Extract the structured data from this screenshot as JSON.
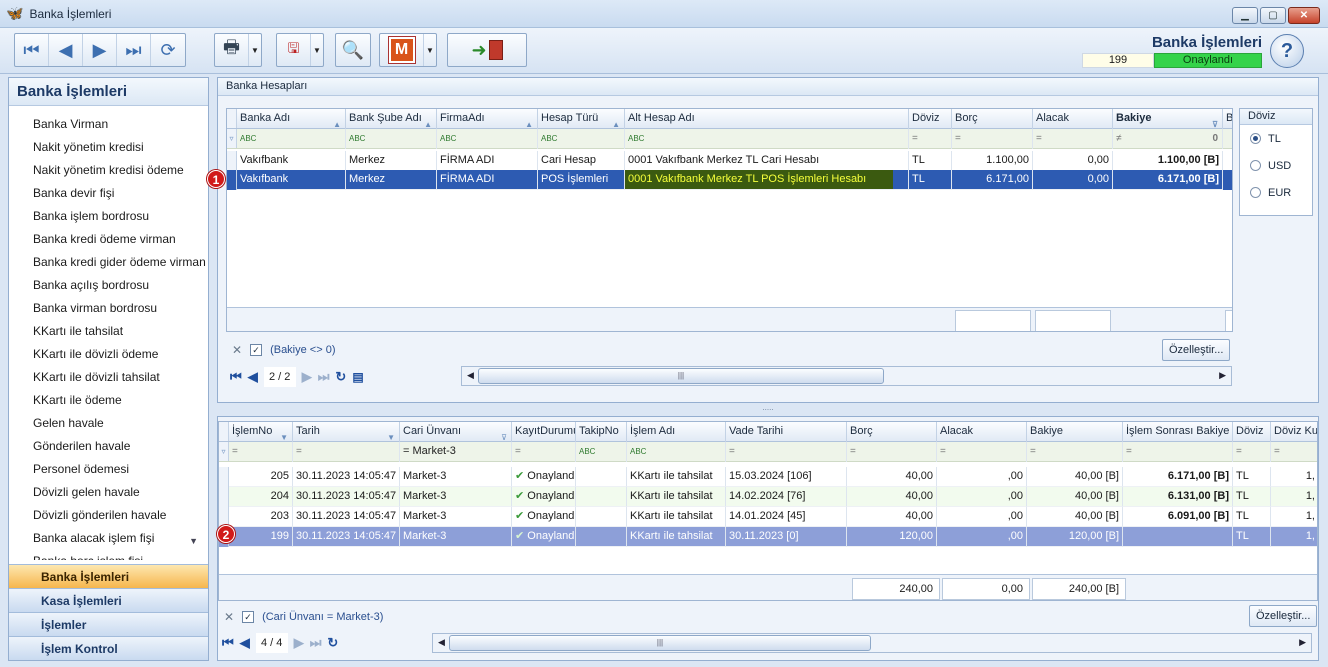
{
  "window": {
    "title": "Banka İşlemleri"
  },
  "header": {
    "title": "Banka İşlemleri",
    "doc_number": "199",
    "status": "Onaylandı"
  },
  "left_panel": {
    "title": "Banka İşlemleri",
    "items": [
      "Banka Virman",
      "Nakit yönetim kredisi",
      "Nakit yönetim kredisi ödeme",
      "Banka devir fişi",
      "Banka işlem bordrosu",
      "Banka kredi ödeme virman",
      "Banka kredi gider ödeme virman",
      "Banka açılış bordrosu",
      "Banka virman bordrosu",
      "KKartı ile tahsilat",
      "KKartı ile dövizli ödeme",
      "KKartı ile dövizli tahsilat",
      "KKartı ile ödeme",
      "Gelen havale",
      "Gönderilen havale",
      "Personel ödemesi",
      "Dövizli gelen havale",
      "Dövizli gönderilen havale",
      "Banka alacak işlem fişi",
      "Banka borç işlem fişi"
    ],
    "nav": [
      "Banka İşlemleri",
      "Kasa İşlemleri",
      "İşlemler",
      "İşlem Kontrol"
    ]
  },
  "bank_accounts": {
    "caption": "Banka Hesapları",
    "columns": [
      "Banka Adı",
      "Bank Şube Adı",
      "FirmaAdı",
      "Hesap Türü",
      "Alt Hesap Adı",
      "Döviz",
      "Borç",
      "Alacak",
      "Bakiye",
      "B"
    ],
    "filter": {
      "abc": "ABC",
      "eq": "=",
      "neq": "≠",
      "zero": "0"
    },
    "rows": [
      [
        "Vakıfbank",
        "Merkez",
        "FİRMA ADI",
        "Cari Hesap",
        "0001 Vakıfbank Merkez TL Cari Hesabı",
        "TL",
        "1.100,00",
        "0,00",
        "1.100,00 [B]"
      ],
      [
        "Vakıfbank",
        "Merkez",
        "FİRMA ADI",
        "POS İşlemleri",
        "0001 Vakıfbank Merkez TL POS İşlemleri Hesabı",
        "TL",
        "6.171,00",
        "0,00",
        "6.171,00 [B]"
      ]
    ],
    "filter_text": "(Bakiye <> 0)",
    "customize": "Özelleştir...",
    "page": "2 / 2",
    "scroll_grip": "|||"
  },
  "doviz": {
    "title": "Döviz",
    "options": [
      "TL",
      "USD",
      "EUR"
    ],
    "selected": "TL"
  },
  "splitter": ".....",
  "transactions": {
    "columns": [
      "İşlemNo",
      "Tarih",
      "Cari Ünvanı",
      "KayıtDurumu",
      "TakipNo",
      "İşlem Adı",
      "Vade Tarihi",
      "Borç",
      "Alacak",
      "Bakiye",
      "İşlem Sonrası Bakiye",
      "Döviz",
      "Döviz Ku"
    ],
    "filter": {
      "eq": "=",
      "cari": "Market-3",
      "abc": "ABC"
    },
    "rows": [
      [
        "205",
        "30.11.2023 14:05:47",
        "Market-3",
        "Onaylandı",
        "",
        "KKartı ile tahsilat",
        "15.03.2024 [106]",
        "40,00",
        ",00",
        "40,00 [B]",
        "6.171,00 [B]",
        "TL",
        "1,"
      ],
      [
        "204",
        "30.11.2023 14:05:47",
        "Market-3",
        "Onaylandı",
        "",
        "KKartı ile tahsilat",
        "14.02.2024 [76]",
        "40,00",
        ",00",
        "40,00 [B]",
        "6.131,00 [B]",
        "TL",
        "1,"
      ],
      [
        "203",
        "30.11.2023 14:05:47",
        "Market-3",
        "Onaylandı",
        "",
        "KKartı ile tahsilat",
        "14.01.2024 [45]",
        "40,00",
        ",00",
        "40,00 [B]",
        "6.091,00 [B]",
        "TL",
        "1,"
      ],
      [
        "199",
        "30.11.2023 14:05:47",
        "Market-3",
        "Onaylandı",
        "",
        "KKartı ile tahsilat",
        "30.11.2023 [0]",
        "120,00",
        ",00",
        "120,00 [B]",
        "",
        "TL",
        "1,"
      ]
    ],
    "totals": [
      "240,00",
      "0,00",
      "240,00 [B]"
    ],
    "filter_text": "(Cari Ünvanı = Market-3)",
    "customize": "Özelleştir...",
    "page": "4 / 4",
    "scroll_grip": "|||"
  },
  "markers": [
    "1",
    "2"
  ]
}
